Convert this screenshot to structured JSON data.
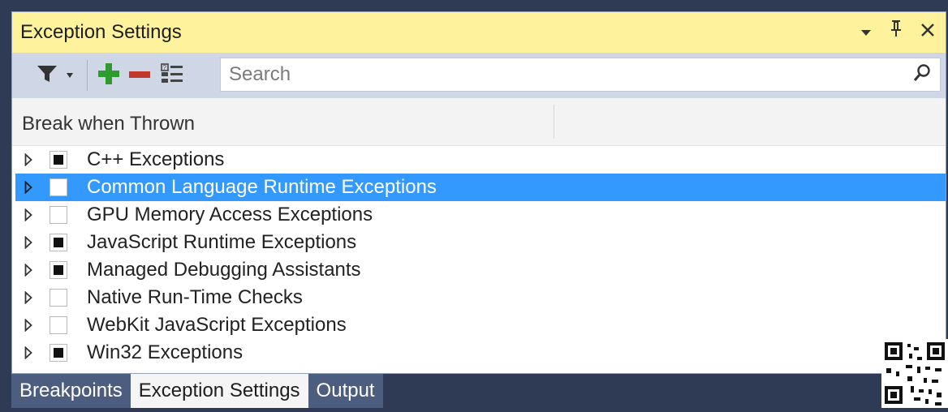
{
  "window": {
    "title": "Exception Settings"
  },
  "toolbar": {
    "filter_icon": "filter-icon",
    "add_icon": "plus-icon",
    "remove_icon": "minus-icon",
    "restore_icon": "restore-defaults-icon",
    "search_placeholder": "Search"
  },
  "header": {
    "column": "Break when Thrown"
  },
  "exceptions": [
    {
      "label": "C++ Exceptions",
      "checked": "indeterminate",
      "selected": false
    },
    {
      "label": "Common Language Runtime Exceptions",
      "checked": "unchecked",
      "selected": true
    },
    {
      "label": "GPU Memory Access Exceptions",
      "checked": "unchecked",
      "selected": false
    },
    {
      "label": "JavaScript Runtime Exceptions",
      "checked": "indeterminate",
      "selected": false
    },
    {
      "label": "Managed Debugging Assistants",
      "checked": "indeterminate",
      "selected": false
    },
    {
      "label": "Native Run-Time Checks",
      "checked": "unchecked",
      "selected": false
    },
    {
      "label": "WebKit JavaScript Exceptions",
      "checked": "unchecked",
      "selected": false
    },
    {
      "label": "Win32 Exceptions",
      "checked": "indeterminate",
      "selected": false
    }
  ],
  "tabs": [
    {
      "label": "Breakpoints",
      "active": false
    },
    {
      "label": "Exception Settings",
      "active": true
    },
    {
      "label": "Output",
      "active": false
    }
  ],
  "colors": {
    "title_bg": "#fff29d",
    "toolbar_bg": "#cfd6e5",
    "selection": "#3399ff",
    "tab_bg": "#4d5d80",
    "add_green": "#2e9b2e",
    "remove_red": "#c0392b"
  }
}
